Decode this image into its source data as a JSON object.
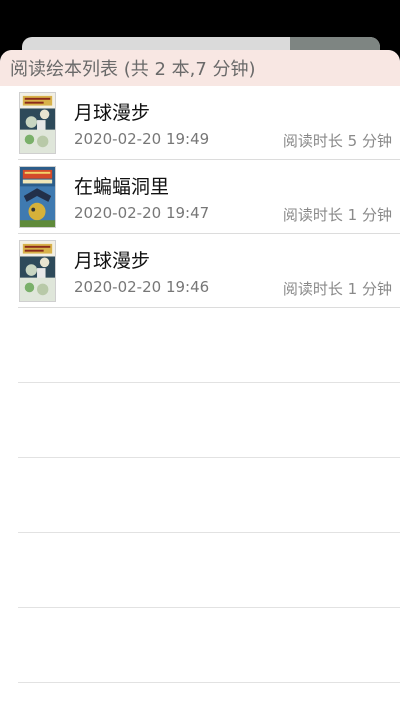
{
  "header": {
    "title": "阅读绘本列表 (共 2 本,7 分钟)"
  },
  "books": [
    {
      "title": "月球漫步",
      "time": "2020-02-20 19:49",
      "duration": "阅读时长 5 分钟",
      "cover_icon": "book-cover-moon-walk"
    },
    {
      "title": "在蝙蝠洞里",
      "time": "2020-02-20 19:47",
      "duration": "阅读时长 1 分钟",
      "cover_icon": "book-cover-bat-cave"
    },
    {
      "title": "月球漫步",
      "time": "2020-02-20 19:46",
      "duration": "阅读时长 1 分钟",
      "cover_icon": "book-cover-moon-walk"
    }
  ],
  "colors": {
    "header_bg": "#f8e7e3",
    "divider": "#dcdcdc",
    "title_text": "#111111",
    "meta_text": "#777777"
  }
}
